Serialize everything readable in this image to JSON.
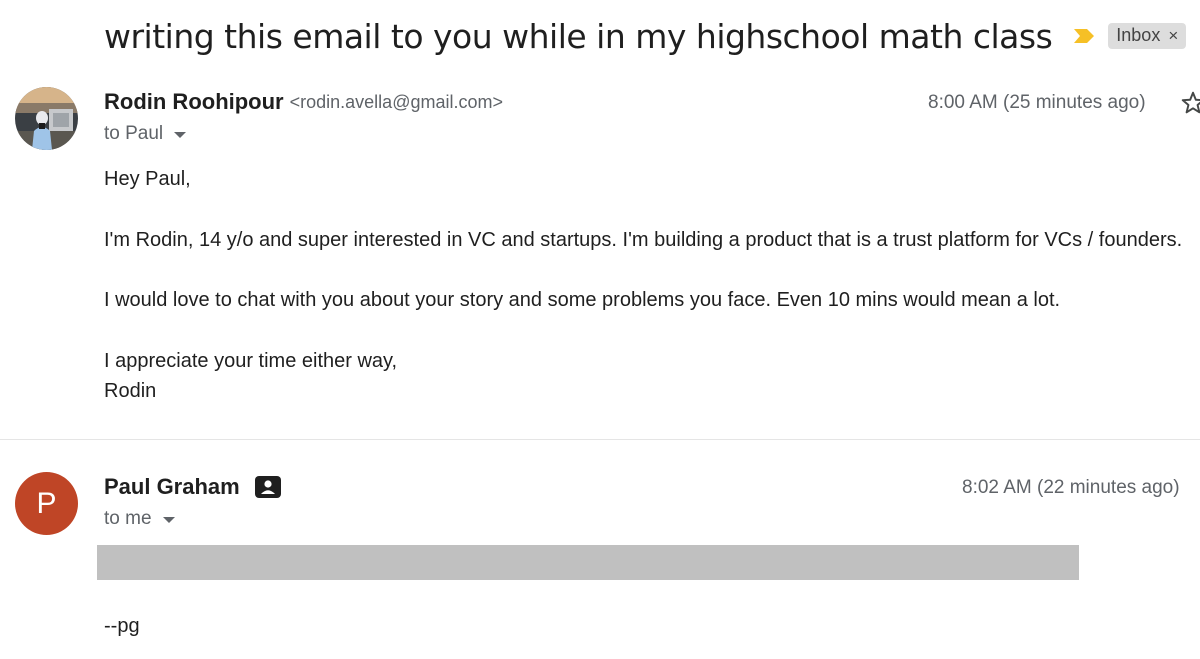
{
  "thread": {
    "subject": "writing this email to you while in my highschool math class",
    "label": "Inbox",
    "label_close": "×"
  },
  "messages": [
    {
      "sender_name": "Rodin Roohipour",
      "sender_email": "<rodin.avella@gmail.com>",
      "recipient": "to Paul",
      "timestamp": "8:00 AM (25 minutes ago)",
      "body": {
        "greeting": "Hey Paul,",
        "paragraph_1": "I'm Rodin, 14 y/o and super interested in VC and startups. I'm building a product that is a trust platform for VCs / founders.",
        "paragraph_2": "I would love to chat with you about your story and some problems you face. Even 10 mins would mean a lot.",
        "closing_line": "I appreciate your time either way,",
        "signature": "Rodin"
      }
    },
    {
      "avatar_letter": "P",
      "sender_name": "Paul Graham",
      "recipient": "to me",
      "timestamp": "8:02 AM (22 minutes ago)",
      "body": {
        "signature": "--pg"
      }
    }
  ],
  "icons": {
    "important_marker": "important-marker-icon",
    "chip_close": "close-icon",
    "star": "star-icon",
    "contact_card": "contact-card-icon",
    "caret": "chevron-down-icon"
  },
  "colors": {
    "important_marker": "#f6c026",
    "avatar_p_background": "#bf4526",
    "label_chip_background": "#dddddd",
    "redaction": "#c0c0c0"
  }
}
